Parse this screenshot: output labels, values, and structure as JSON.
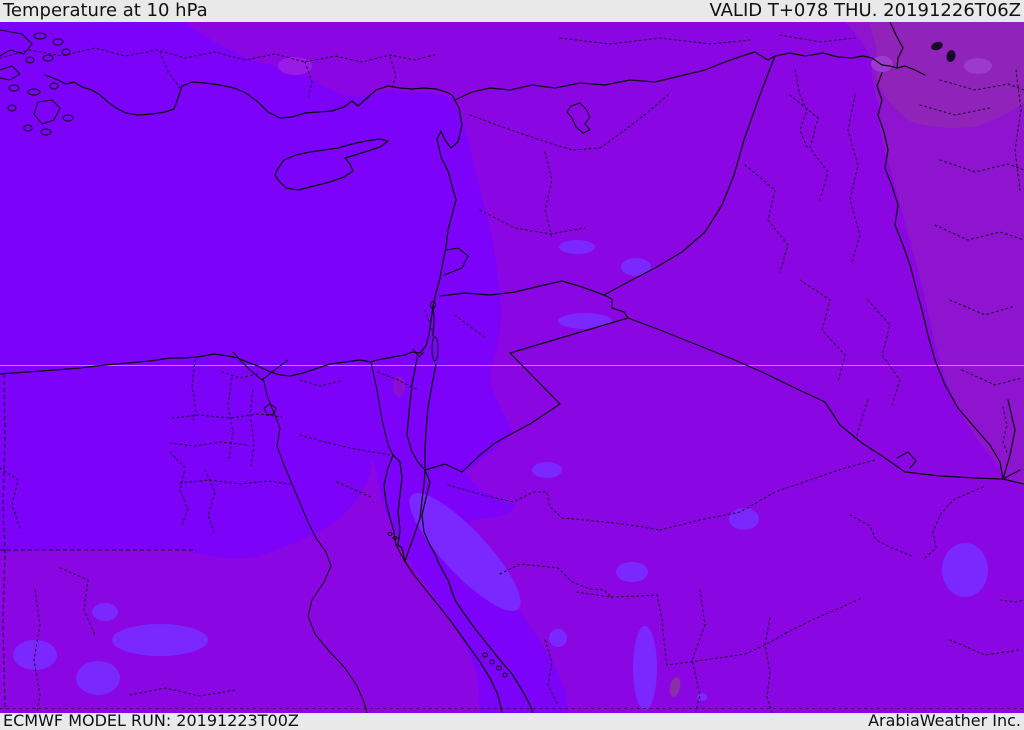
{
  "header": {
    "title": "Temperature at 10 hPa",
    "valid": "VALID T+078 THU. 20191226T06Z"
  },
  "footer": {
    "model_run": "ECMWF MODEL RUN: 20191223T00Z",
    "brand": "ArabiaWeather Inc."
  },
  "map": {
    "description": "Filled temperature shading at the 10 hPa level over the eastern Mediterranean, Turkey, the Levant, Egypt, Iraq, Iran and the Arabian Peninsula; warmer-coded violet in the west/south grading to darker purple toward the northeast.",
    "palette": {
      "page_bg": "#e9e9e9",
      "bar_bg": "#e9e9e9",
      "text": "#111111",
      "base": "#7c02fa",
      "band_light": "#7a28ff",
      "medium": "#8a06e2",
      "dark": "#8e14cf",
      "darkest": "#8f23ba",
      "spot_light_warm": "#9a1be8",
      "spot_light_cool": "#9c39cf",
      "spot_dark": "#8b0ed2",
      "spot_dark_muted": "#8a2fa6",
      "border_line": "#0a0a0a",
      "admin_line": "#1a0828",
      "graticule_light": "rgba(235,222,255,0.55)",
      "graticule_dark": "rgba(25,5,45,0.75)"
    },
    "shading_levels": [
      {
        "role": "band_light",
        "note": "lightest blue-violet pools (Red Sea axis, Sudan, interior Saudi pools)"
      },
      {
        "role": "base",
        "note": "bright violet over Mediterranean, Turkey, Egypt, Levant"
      },
      {
        "role": "medium",
        "note": "medium purple over Syria, Jordan, Saudi Arabia, southern Egypt/Sudan belt"
      },
      {
        "role": "dark",
        "note": "darker purple over eastern Iraq and Iran"
      },
      {
        "role": "darkest",
        "note": "darkest muted purple over northwest Iran / far northeast corner"
      }
    ]
  }
}
